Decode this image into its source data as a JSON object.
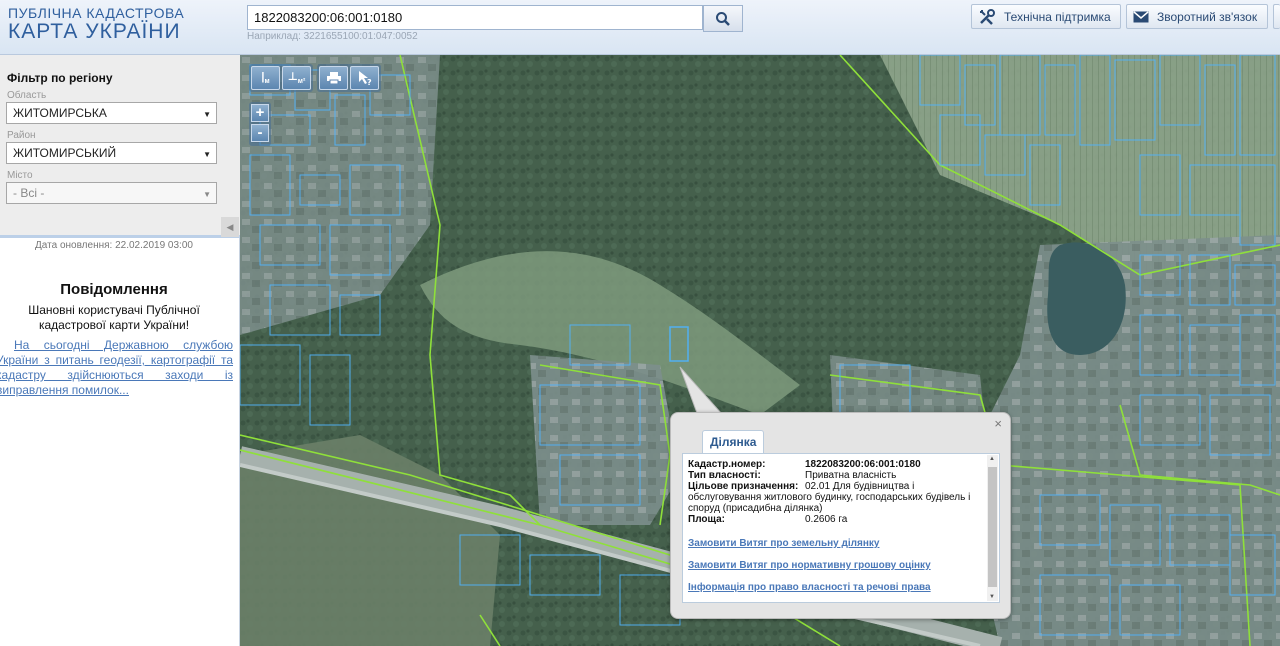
{
  "header": {
    "logo_line1": "ПУБЛІЧНА КАДАСТРОВА",
    "logo_line2": "КАРТА УКРАЇНИ",
    "search_value": "1822083200:06:001:0180",
    "search_example": "Наприклад: 3221655100:01:047:0052",
    "support_label": "Технічна підтримка",
    "feedback_label": "Зворотний зв'язок"
  },
  "sidebar": {
    "filter_title": "Фільтр по регіону",
    "region_label": "Область",
    "region_value": "ЖИТОМИРСЬКА",
    "district_label": "Район",
    "district_value": "ЖИТОМИРСЬКИЙ",
    "city_label": "Місто",
    "city_value": "- Всі -",
    "update_date": "Дата оновлення: 22.02.2019 03:00",
    "notice_title": "Повідомлення",
    "notice_greeting": "Шановні користувачі Публічної кадастрової карти України!",
    "notice_link": "На сьогодні Державною службою України з питань геодезії, картографії та кадастру здійснюються заходи із виправлення помилок..."
  },
  "map_toolbar": {
    "measure_line_label": "м",
    "measure_area_label": "м²",
    "zoom_in": "+",
    "zoom_out": "-"
  },
  "popup": {
    "tab_label": "Ділянка",
    "close_label": "×",
    "cadastral_key": "Кадастр.номер:",
    "cadastral_value": "1822083200:06:001:0180",
    "ownership_key": "Тип власності:",
    "ownership_value": "Приватна власність",
    "purpose_key": "Цільове призначення:",
    "purpose_value": "02.01 Для будівництва і обслуговування житлового будинку, господарських будівель і споруд (присадибна ділянка)",
    "area_key": "Площа:",
    "area_value": "0.2606 га",
    "link_extract": "Замовити Витяг про земельну ділянку",
    "link_valuation": "Замовити Витяг про нормативну грошову оцінку",
    "link_rights": "Інформація про право власності та речові права"
  },
  "colors": {
    "parcel_outline": "#4fb4ff",
    "boundary_line": "#8fe03a",
    "header_text": "#2f5f9e"
  }
}
